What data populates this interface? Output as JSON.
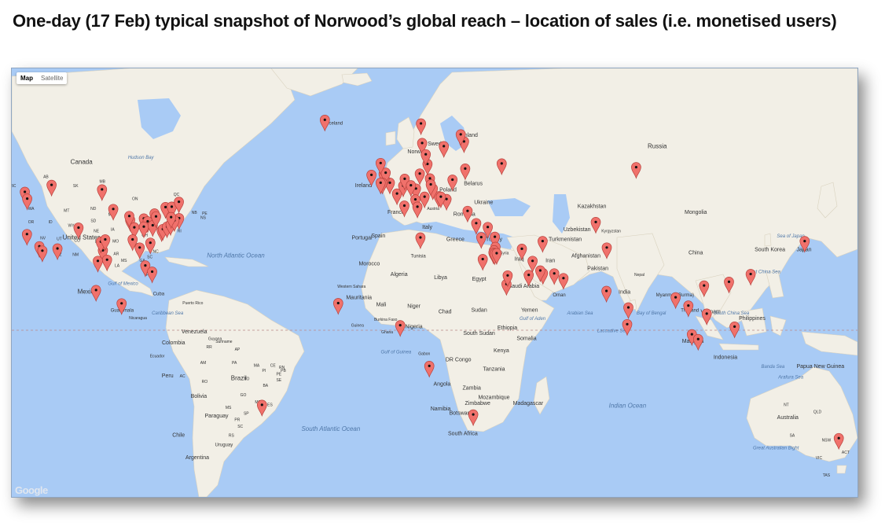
{
  "title": "One-day (17 Feb) typical snapshot of Norwood’s global reach – location of sales (i.e. monetised users)",
  "map": {
    "type_control": {
      "map": "Map",
      "satellite": "Satellite"
    },
    "attribution": "Google",
    "colors": {
      "ocean": "#a9cbf5",
      "land": "#f2efe6",
      "marker": "#f0716b",
      "marker_dot": "#111111"
    },
    "labels": {
      "canada": "Canada",
      "hudson_bay": "Hudson Bay",
      "ab": "AB",
      "bc": "BC",
      "sk": "SK",
      "mb": "MB",
      "on": "ON",
      "qc": "QC",
      "nb": "NB",
      "pe": "PE",
      "ns": "NS",
      "wa": "WA",
      "mt": "MT",
      "nd": "ND",
      "or": "OR",
      "id": "ID",
      "wy": "WY",
      "sd": "SD",
      "mn": "MN",
      "nv": "NV",
      "ut": "UT",
      "ne": "NE",
      "ia": "IA",
      "united_states": "United States",
      "co": "CO",
      "ks": "KS",
      "mo": "MO",
      "ky": "KY",
      "wv": "WV",
      "az": "AZ",
      "nm": "NM",
      "ok": "OK",
      "ar": "AR",
      "nc": "NC",
      "sc": "SC",
      "ms": "MS",
      "ga": "GA",
      "tx": "TX",
      "la": "LA",
      "oh": "OH",
      "north_atlantic": "North Atlantic Ocean",
      "mexico": "Mexico",
      "gulf_mexico": "Gulf of Mexico",
      "cuba": "Cuba",
      "puerto_rico": "Puerto Rico",
      "guatemala": "Guatemala",
      "nicaragua": "Nicaragua",
      "caribbean": "Caribbean Sea",
      "venezuela": "Venezuela",
      "guyana": "Guyana",
      "suriname": "Suriname",
      "colombia": "Colombia",
      "ecuador": "Ecuador",
      "peru": "Peru",
      "brazil": "Brazil",
      "bolivia": "Bolivia",
      "paraguay": "Paraguay",
      "chile": "Chile",
      "uruguay": "Uruguay",
      "argentina": "Argentina",
      "south_atlantic": "South Atlantic Ocean",
      "iceland": "Iceland",
      "sweden": "Sweden",
      "finland": "Finland",
      "norway": "Norway",
      "ireland": "Ireland",
      "poland": "Poland",
      "belarus": "Belarus",
      "ukraine": "Ukraine",
      "france": "France",
      "austria": "Austria",
      "romania": "Romania",
      "spain": "Spain",
      "portugal": "Portugal",
      "italy": "Italy",
      "greece": "Greece",
      "turkey": "Turkey",
      "russia": "Russia",
      "kazakhstan": "Kazakhstan",
      "mongolia": "Mongolia",
      "uzbekistan": "Uzbekistan",
      "kyrgyzstan": "Kyrgyzstan",
      "turkmenistan": "Turkmenistan",
      "syria": "Syria",
      "iraq": "Iraq",
      "iran": "Iran",
      "afghanistan": "Afghanistan",
      "pakistan": "Pakistan",
      "china": "China",
      "south_korea": "South Korea",
      "japan": "Japan",
      "sea_japan": "Sea of Japan",
      "east_china_sea": "East China Sea",
      "nepal": "Nepal",
      "india": "India",
      "myanmar": "Myanmar (Burma)",
      "thailand": "Thailand",
      "vietnam": "Vietnam",
      "philippines": "Philippines",
      "south_china_sea": "South China Sea",
      "bay_bengal": "Bay of Bengal",
      "arabian_sea": "Arabian Sea",
      "laccadive": "Laccadive Sea",
      "malaysia": "Malaysia",
      "indonesia": "Indonesia",
      "banda_sea": "Banda Sea",
      "arafura_sea": "Arafura Sea",
      "papua": "Papua New Guinea",
      "morocco": "Morocco",
      "tunisia": "Tunisia",
      "algeria": "Algeria",
      "libya": "Libya",
      "egypt": "Egypt",
      "saudi_arabia": "Saudi Arabia",
      "oman": "Oman",
      "yemen": "Yemen",
      "gulf_aden": "Gulf of Aden",
      "western_sahara": "Western Sahara",
      "mauritania": "Mauritania",
      "mali": "Mali",
      "niger": "Niger",
      "chad": "Chad",
      "sudan": "Sudan",
      "burkina": "Burkina Faso",
      "guinea": "Guinea",
      "ghana": "Ghana",
      "nigeria": "Nigeria",
      "south_sudan": "South Sudan",
      "ethiopia": "Ethiopia",
      "somalia": "Somalia",
      "gulf_guinea": "Gulf of Guinea",
      "gabon": "Gabon",
      "dr_congo": "DR Congo",
      "kenya": "Kenya",
      "tanzania": "Tanzania",
      "angola": "Angola",
      "zambia": "Zambia",
      "mozambique": "Mozambique",
      "namibia": "Namibia",
      "zimbabwe": "Zimbabwe",
      "botswana": "Botswana",
      "madagascar": "Madagascar",
      "south_africa": "South Africa",
      "indian_ocean": "Indian Ocean",
      "australia": "Australia",
      "nt": "NT",
      "qld": "QLD",
      "sa": "SA",
      "nsw": "NSW",
      "vic": "VIC",
      "tas": "TAS",
      "act": "ACT",
      "great_bight": "Great Australian Bight",
      "am": "AM",
      "pa": "PA",
      "ma": "MA",
      "ce": "CE",
      "pi": "PI",
      "ba": "BA",
      "to": "TO",
      "go": "GO",
      "mg": "MG",
      "ro": "RO",
      "ac": "AC",
      "ap": "AP",
      "rr": "RR",
      "ms_br": "MS",
      "sp": "SP",
      "pr": "PR",
      "sc_br": "SC",
      "rs": "RS",
      "es": "ES",
      "se": "SE",
      "pb": "PB",
      "rn": "RN",
      "fl": "FL",
      "pe_br": "PE",
      "ri": "RI"
    },
    "markers": [
      {
        "name": "Vancouver",
        "lat": 49.3,
        "lng": -123.1
      },
      {
        "name": "Calgary",
        "lat": 51.0,
        "lng": -114.1
      },
      {
        "name": "Winnipeg",
        "lat": 49.9,
        "lng": -97.1
      },
      {
        "name": "Seattle",
        "lat": 47.6,
        "lng": -122.3
      },
      {
        "name": "San Francisco",
        "lat": 37.8,
        "lng": -122.4
      },
      {
        "name": "Los Angeles",
        "lat": 34.1,
        "lng": -118.2
      },
      {
        "name": "San Diego",
        "lat": 32.7,
        "lng": -117.2
      },
      {
        "name": "Phoenix",
        "lat": 33.4,
        "lng": -112.1
      },
      {
        "name": "Denver",
        "lat": 39.7,
        "lng": -105.0
      },
      {
        "name": "Dallas",
        "lat": 32.8,
        "lng": -96.8
      },
      {
        "name": "Houston",
        "lat": 29.8,
        "lng": -95.4
      },
      {
        "name": "San Antonio",
        "lat": 29.4,
        "lng": -98.5
      },
      {
        "name": "Oklahoma City",
        "lat": 35.5,
        "lng": -97.5
      },
      {
        "name": "Tulsa",
        "lat": 36.2,
        "lng": -96.0
      },
      {
        "name": "Minneapolis",
        "lat": 44.9,
        "lng": -93.3
      },
      {
        "name": "Chicago",
        "lat": 41.9,
        "lng": -87.6
      },
      {
        "name": "Milwaukee",
        "lat": 43.0,
        "lng": -87.9
      },
      {
        "name": "Indianapolis",
        "lat": 39.8,
        "lng": -86.2
      },
      {
        "name": "Detroit",
        "lat": 42.3,
        "lng": -83.0
      },
      {
        "name": "Cleveland",
        "lat": 41.5,
        "lng": -81.7
      },
      {
        "name": "Columbus",
        "lat": 40.0,
        "lng": -83.0
      },
      {
        "name": "Pittsburgh",
        "lat": 40.4,
        "lng": -80.0
      },
      {
        "name": "Atlanta",
        "lat": 33.7,
        "lng": -84.4
      },
      {
        "name": "Nashville",
        "lat": 36.2,
        "lng": -86.8
      },
      {
        "name": "Charlotte",
        "lat": 35.2,
        "lng": -80.8
      },
      {
        "name": "Tampa",
        "lat": 27.9,
        "lng": -82.5
      },
      {
        "name": "Miami",
        "lat": 25.8,
        "lng": -80.2
      },
      {
        "name": "Washington",
        "lat": 38.9,
        "lng": -77.0
      },
      {
        "name": "Baltimore",
        "lat": 39.3,
        "lng": -76.6
      },
      {
        "name": "Philadelphia",
        "lat": 40.0,
        "lng": -75.2
      },
      {
        "name": "New York",
        "lat": 40.7,
        "lng": -74.0
      },
      {
        "name": "Boston",
        "lat": 42.4,
        "lng": -71.1
      },
      {
        "name": "Hartford",
        "lat": 41.8,
        "lng": -72.7
      },
      {
        "name": "Toronto",
        "lat": 43.7,
        "lng": -79.4
      },
      {
        "name": "Ottawa",
        "lat": 45.4,
        "lng": -75.7
      },
      {
        "name": "Montreal",
        "lat": 45.5,
        "lng": -73.6
      },
      {
        "name": "Quebec",
        "lat": 46.8,
        "lng": -71.2
      },
      {
        "name": "Buffalo",
        "lat": 42.9,
        "lng": -78.9
      },
      {
        "name": "Albany",
        "lat": 42.7,
        "lng": -73.8
      },
      {
        "name": "Mexico City",
        "lat": 19.4,
        "lng": -99.1
      },
      {
        "name": "Guatemala City",
        "lat": 14.6,
        "lng": -90.5
      },
      {
        "name": "Rio de Janeiro",
        "lat": -22.9,
        "lng": -43.2
      },
      {
        "name": "Reykjavik area",
        "lat": 64.0,
        "lng": -22.0
      },
      {
        "name": "Dublin",
        "lat": 53.3,
        "lng": -6.3
      },
      {
        "name": "London",
        "lat": 51.5,
        "lng": -0.1
      },
      {
        "name": "Birmingham",
        "lat": 52.5,
        "lng": -1.9
      },
      {
        "name": "Manchester",
        "lat": 53.5,
        "lng": -2.2
      },
      {
        "name": "Paris",
        "lat": 48.9,
        "lng": 2.3
      },
      {
        "name": "Brussels",
        "lat": 50.8,
        "lng": 4.4
      },
      {
        "name": "Amsterdam",
        "lat": 52.4,
        "lng": 4.9
      },
      {
        "name": "Hamburg",
        "lat": 53.6,
        "lng": 10.0
      },
      {
        "name": "Berlin",
        "lat": 52.5,
        "lng": 13.4
      },
      {
        "name": "Frankfurt",
        "lat": 50.1,
        "lng": 8.7
      },
      {
        "name": "Munich",
        "lat": 48.1,
        "lng": 11.6
      },
      {
        "name": "Zurich",
        "lat": 47.4,
        "lng": 8.5
      },
      {
        "name": "Milan",
        "lat": 45.5,
        "lng": 9.2
      },
      {
        "name": "Copenhagen",
        "lat": 55.7,
        "lng": 12.6
      },
      {
        "name": "Oslo",
        "lat": 59.9,
        "lng": 10.8
      },
      {
        "name": "Stockholm",
        "lat": 59.3,
        "lng": 18.1
      },
      {
        "name": "Gothenburg",
        "lat": 57.7,
        "lng": 12.0
      },
      {
        "name": "Trondheim",
        "lat": 63.4,
        "lng": 10.4
      },
      {
        "name": "Helsinki",
        "lat": 60.2,
        "lng": 24.9
      },
      {
        "name": "Tampere",
        "lat": 61.5,
        "lng": 23.8
      },
      {
        "name": "Warsaw",
        "lat": 52.2,
        "lng": 21.0
      },
      {
        "name": "Vilnius",
        "lat": 54.7,
        "lng": 25.3
      },
      {
        "name": "Vienna",
        "lat": 48.2,
        "lng": 16.4
      },
      {
        "name": "Budapest",
        "lat": 47.5,
        "lng": 19.0
      },
      {
        "name": "Bucharest",
        "lat": 44.4,
        "lng": 26.1
      },
      {
        "name": "Moscow",
        "lat": 55.8,
        "lng": 37.6
      },
      {
        "name": "Novosibirsk",
        "lat": 55.0,
        "lng": 82.9
      },
      {
        "name": "Istanbul",
        "lat": 41.0,
        "lng": 29.0
      },
      {
        "name": "Ankara",
        "lat": 39.9,
        "lng": 32.9
      },
      {
        "name": "Antalya",
        "lat": 36.9,
        "lng": 30.7
      },
      {
        "name": "Adana",
        "lat": 37.0,
        "lng": 35.3
      },
      {
        "name": "Beirut",
        "lat": 33.9,
        "lng": 35.5
      },
      {
        "name": "Haifa",
        "lat": 32.8,
        "lng": 35.0
      },
      {
        "name": "Tel Aviv",
        "lat": 32.1,
        "lng": 34.8
      },
      {
        "name": "Jerusalem",
        "lat": 31.8,
        "lng": 35.2
      },
      {
        "name": "Amman",
        "lat": 31.9,
        "lng": 35.9
      },
      {
        "name": "Baghdad",
        "lat": 33.3,
        "lng": 44.4
      },
      {
        "name": "Kuwait",
        "lat": 29.4,
        "lng": 48.0
      },
      {
        "name": "Tehran",
        "lat": 35.7,
        "lng": 51.4
      },
      {
        "name": "Riyadh",
        "lat": 24.7,
        "lng": 46.7
      },
      {
        "name": "Jeddah",
        "lat": 21.5,
        "lng": 39.2
      },
      {
        "name": "Medina",
        "lat": 24.5,
        "lng": 39.6
      },
      {
        "name": "Doha",
        "lat": 25.3,
        "lng": 51.5
      },
      {
        "name": "Dubai",
        "lat": 25.2,
        "lng": 55.3
      },
      {
        "name": "Bahrain",
        "lat": 26.2,
        "lng": 50.6
      },
      {
        "name": "Muscat",
        "lat": 23.6,
        "lng": 58.4
      },
      {
        "name": "Tashkent",
        "lat": 41.3,
        "lng": 69.3
      },
      {
        "name": "Islamabad",
        "lat": 33.7,
        "lng": 73.0
      },
      {
        "name": "Mumbai",
        "lat": 19.1,
        "lng": 72.9
      },
      {
        "name": "Chennai",
        "lat": 13.1,
        "lng": 80.3
      },
      {
        "name": "Colombo",
        "lat": 6.9,
        "lng": 79.9
      },
      {
        "name": "Yangon",
        "lat": 16.8,
        "lng": 96.2
      },
      {
        "name": "Bangkok",
        "lat": 13.8,
        "lng": 100.5
      },
      {
        "name": "Hanoi",
        "lat": 21.0,
        "lng": 105.8
      },
      {
        "name": "Ho Chi Minh City",
        "lat": 10.8,
        "lng": 106.7
      },
      {
        "name": "Kuala Lumpur",
        "lat": 3.1,
        "lng": 101.7
      },
      {
        "name": "Singapore",
        "lat": 1.3,
        "lng": 103.8
      },
      {
        "name": "Kota Kinabalu",
        "lat": 5.98,
        "lng": 116.07
      },
      {
        "name": "Hong Kong",
        "lat": 22.3,
        "lng": 114.2
      },
      {
        "name": "Taipei",
        "lat": 25.0,
        "lng": 121.5
      },
      {
        "name": "Tokyo",
        "lat": 35.7,
        "lng": 139.7
      },
      {
        "name": "Sydney",
        "lat": -33.9,
        "lng": 151.2
      },
      {
        "name": "Tunis",
        "lat": 36.8,
        "lng": 10.2
      },
      {
        "name": "Cairo",
        "lat": 30.0,
        "lng": 31.2
      },
      {
        "name": "Dakar",
        "lat": 14.7,
        "lng": -17.5
      },
      {
        "name": "Lagos",
        "lat": 6.5,
        "lng": 3.4
      },
      {
        "name": "Luanda",
        "lat": -8.8,
        "lng": 13.2
      },
      {
        "name": "Johannesburg",
        "lat": -26.2,
        "lng": 28.0
      },
      {
        "name": "Bratislava",
        "lat": 48.1,
        "lng": 17.1
      },
      {
        "name": "Lyon",
        "lat": 45.8,
        "lng": 4.8
      },
      {
        "name": "Cologne",
        "lat": 50.9,
        "lng": 7.0
      },
      {
        "name": "Leeds",
        "lat": 53.8,
        "lng": -1.5
      },
      {
        "name": "Bristol",
        "lat": 51.5,
        "lng": -2.6
      },
      {
        "name": "Cardiff",
        "lat": 51.5,
        "lng": -3.2
      },
      {
        "name": "Prague",
        "lat": 50.1,
        "lng": 14.4
      },
      {
        "name": "Dresden",
        "lat": 51.1,
        "lng": 13.7
      },
      {
        "name": "Edinburgh",
        "lat": 55.9,
        "lng": -3.2
      }
    ]
  }
}
